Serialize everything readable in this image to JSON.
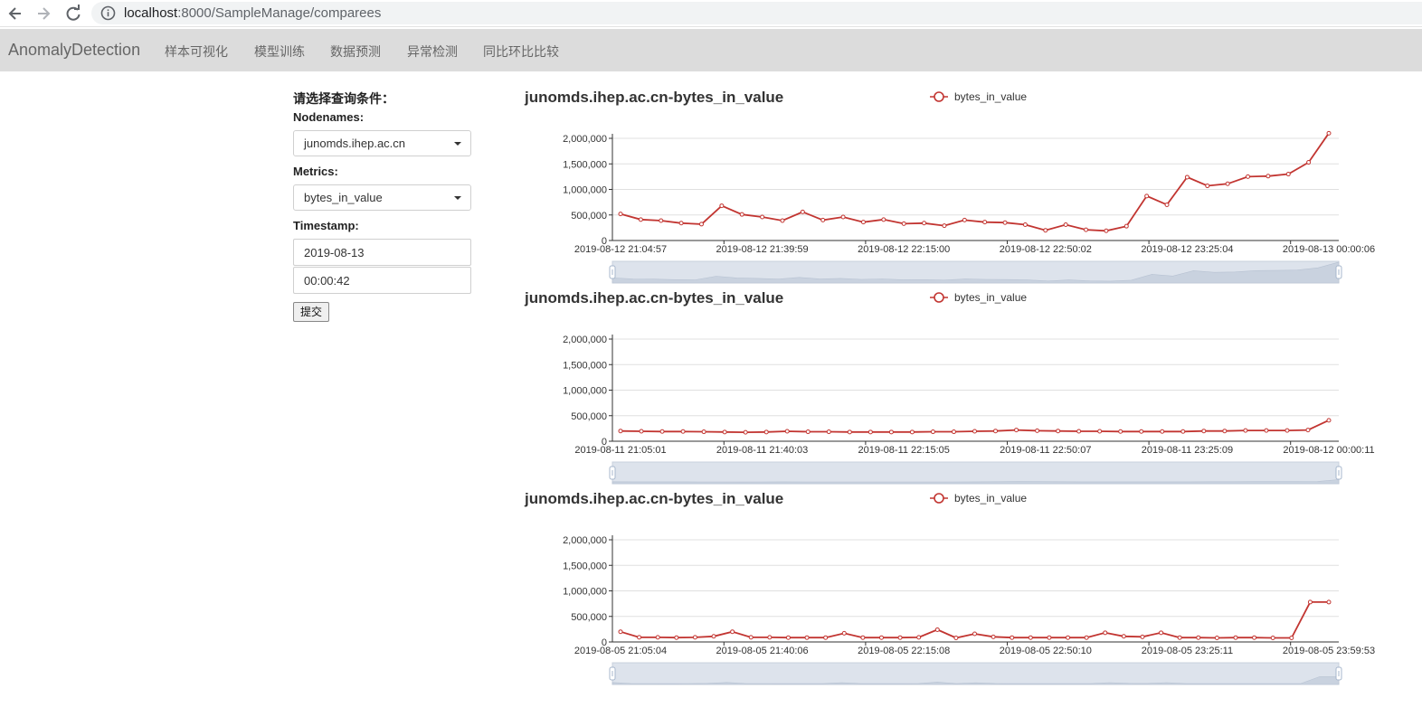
{
  "browser": {
    "url_host": "localhost",
    "url_path": ":8000/SampleManage/comparees"
  },
  "navbar": {
    "brand": "AnomalyDetection",
    "items": [
      "样本可视化",
      "模型训练",
      "数据预测",
      "异常检测",
      "同比环比比较"
    ]
  },
  "form": {
    "title": "请选择查询条件：",
    "nodenames_label": "Nodenames:",
    "nodenames_value": "junomds.ihep.ac.cn",
    "metrics_label": "Metrics:",
    "metrics_value": "bytes_in_value",
    "timestamp_label": "Timestamp:",
    "date_value": "2019-08-13",
    "time_value": "00:00:42",
    "submit_label": "提交"
  },
  "colors": {
    "series": "#c23531",
    "datazoom": "#dde3ec"
  },
  "chart_data": [
    {
      "type": "line",
      "title": "junomds.ihep.ac.cn-bytes_in_value",
      "legend": "bytes_in_value",
      "legend_position": "top-center",
      "ylim": [
        0,
        2000000
      ],
      "yticks": [
        "0",
        "500,000",
        "1,000,000",
        "1,500,000",
        "2,000,000"
      ],
      "xticks": [
        "2019-08-12 21:04:57",
        "2019-08-12 21:39:59",
        "2019-08-12 22:15:00",
        "2019-08-12 22:50:02",
        "2019-08-12 23:25:04",
        "2019-08-13 00:00:06"
      ],
      "series": [
        {
          "name": "bytes_in_value",
          "values": [
            520000,
            410000,
            390000,
            340000,
            320000,
            680000,
            510000,
            460000,
            390000,
            560000,
            400000,
            460000,
            360000,
            410000,
            330000,
            340000,
            290000,
            400000,
            360000,
            350000,
            310000,
            200000,
            310000,
            210000,
            190000,
            280000,
            870000,
            700000,
            1240000,
            1070000,
            1110000,
            1250000,
            1260000,
            1300000,
            1530000,
            2100000
          ]
        }
      ]
    },
    {
      "type": "line",
      "title": "junomds.ihep.ac.cn-bytes_in_value",
      "legend": "bytes_in_value",
      "legend_position": "top-center",
      "ylim": [
        0,
        2000000
      ],
      "yticks": [
        "0",
        "500,000",
        "1,000,000",
        "1,500,000",
        "2,000,000"
      ],
      "xticks": [
        "2019-08-11 21:05:01",
        "2019-08-11 21:40:03",
        "2019-08-11 22:15:05",
        "2019-08-11 22:50:07",
        "2019-08-11 23:25:09",
        "2019-08-12 00:00:11"
      ],
      "series": [
        {
          "name": "bytes_in_value",
          "values": [
            200000,
            195000,
            190000,
            190000,
            185000,
            180000,
            175000,
            180000,
            195000,
            185000,
            185000,
            180000,
            180000,
            180000,
            180000,
            185000,
            185000,
            195000,
            200000,
            220000,
            205000,
            200000,
            195000,
            195000,
            190000,
            190000,
            190000,
            190000,
            200000,
            200000,
            210000,
            210000,
            210000,
            220000,
            410000
          ]
        }
      ]
    },
    {
      "type": "line",
      "title": "junomds.ihep.ac.cn-bytes_in_value",
      "legend": "bytes_in_value",
      "legend_position": "top-center",
      "ylim": [
        0,
        2000000
      ],
      "yticks": [
        "0",
        "500,000",
        "1,000,000",
        "1,500,000",
        "2,000,000"
      ],
      "xticks": [
        "2019-08-05 21:05:04",
        "2019-08-05 21:40:06",
        "2019-08-05 22:15:08",
        "2019-08-05 22:50:10",
        "2019-08-05 23:25:11",
        "2019-08-05 23:59:53"
      ],
      "series": [
        {
          "name": "bytes_in_value",
          "values": [
            200000,
            90000,
            90000,
            85000,
            90000,
            110000,
            200000,
            90000,
            90000,
            85000,
            85000,
            85000,
            170000,
            85000,
            85000,
            85000,
            90000,
            240000,
            80000,
            160000,
            100000,
            85000,
            85000,
            85000,
            85000,
            85000,
            180000,
            110000,
            100000,
            180000,
            85000,
            85000,
            80000,
            85000,
            85000,
            80000,
            80000,
            780000,
            780000
          ]
        }
      ]
    }
  ]
}
